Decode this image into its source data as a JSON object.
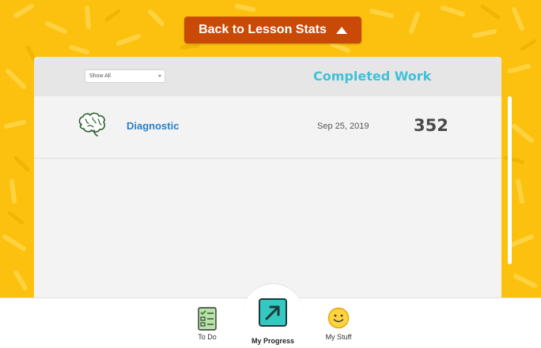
{
  "header": {
    "back_label": "Back to Lesson Stats",
    "back_icon": "triangle-up-icon"
  },
  "panel": {
    "filter": {
      "selected": "Show All"
    },
    "title": "Completed Work",
    "rows": [
      {
        "icon": "brain-icon",
        "name": "Diagnostic",
        "date": "Sep 25, 2019",
        "score": "352"
      }
    ]
  },
  "nav": {
    "items": [
      {
        "label": "To Do",
        "icon": "checklist-icon",
        "active": false
      },
      {
        "label": "My Progress",
        "icon": "arrow-up-right-icon",
        "active": true
      },
      {
        "label": "My Stuff",
        "icon": "smiley-icon",
        "active": false
      }
    ]
  },
  "colors": {
    "background": "#fcc10e",
    "back_button": "#c94a07",
    "title": "#3fc1d8",
    "link": "#2780c6",
    "progress_icon": "#35c7c1"
  }
}
